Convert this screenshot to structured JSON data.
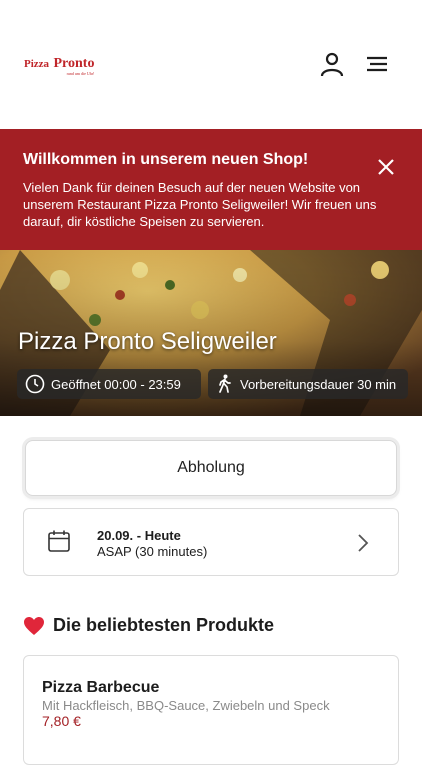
{
  "header": {
    "logo_word1": "Pizza",
    "logo_word2": "Pronto",
    "logo_tagline": "rund um die Uhr!"
  },
  "banner": {
    "title": "Willkommen in unserem neuen Shop!",
    "message": "Vielen Dank für deinen Besuch auf der neuen Website von unserem Restaurant Pizza Pronto Seligweiler! Wir freuen uns darauf, dir köstliche Speisen zu servieren."
  },
  "hero": {
    "restaurant_name": "Pizza Pronto Seligweiler",
    "hours": "Geöffnet 00:00 - 23:59",
    "prep_time": "Vorbereitungsdauer 30 min"
  },
  "order": {
    "mode_label": "Abholung",
    "date_line": "20.09. - Heute",
    "time_line": "ASAP (30 minutes)"
  },
  "popular": {
    "title": "Die beliebtesten Produkte",
    "products": [
      {
        "name": "Pizza Barbecue",
        "description": "Mit Hackfleisch, BBQ-Sauce, Zwiebeln und Speck",
        "price": "7,80 €"
      }
    ]
  },
  "colors": {
    "brand_red": "#a31f24",
    "icon_dark": "#1d1d1d"
  },
  "icons": [
    "user-icon",
    "menu-icon",
    "close-icon",
    "clock-icon",
    "walking-icon",
    "calendar-icon",
    "chevron-right-icon",
    "heart-icon"
  ]
}
